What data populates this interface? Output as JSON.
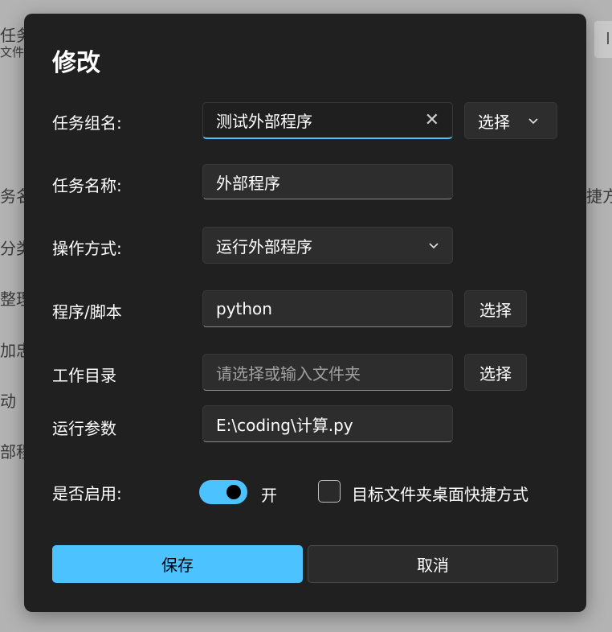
{
  "background": {
    "top_left_line1": "任务",
    "top_left_line2": "文件",
    "left_fragments": [
      "务名",
      "分类",
      "整理",
      "加忠",
      "动",
      "部程"
    ],
    "right_fragment": "捷方式",
    "right_box_text": "I"
  },
  "dialog": {
    "title": "修改",
    "group": {
      "label": "任务组名:",
      "value": "测试外部程序",
      "select_label": "选择"
    },
    "task_name": {
      "label": "任务名称:",
      "value": "外部程序"
    },
    "operation": {
      "label": "操作方式:",
      "value": "运行外部程序"
    },
    "program": {
      "label": "程序/脚本",
      "value": "python",
      "select_label": "选择"
    },
    "workdir": {
      "label": "工作目录",
      "placeholder": "请选择或输入文件夹",
      "select_label": "选择"
    },
    "args": {
      "label": "运行参数",
      "value": "E:\\coding\\计算.py"
    },
    "enabled": {
      "label": "是否启用:",
      "state_text": "开",
      "is_on": true
    },
    "shortcut": {
      "label": "目标文件夹桌面快捷方式",
      "checked": false
    },
    "save_label": "保存",
    "cancel_label": "取消"
  },
  "colors": {
    "accent": "#4cc2ff",
    "dialog_bg": "#202020",
    "field_bg": "#2d2d2d"
  }
}
